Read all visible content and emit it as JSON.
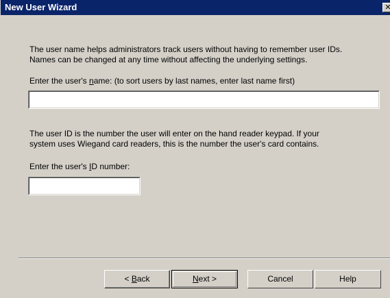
{
  "window": {
    "title": "New User Wizard",
    "close_glyph": "✕"
  },
  "intro": {
    "line1": "The user name helps administrators track users without having to remember user IDs.",
    "line2": "Names can be changed at any time without affecting the underlying settings."
  },
  "name_field": {
    "label_prefix": "Enter the user's ",
    "label_mnemonic": "n",
    "label_rest": "ame: (to sort users by last names, enter last name first)",
    "value": "",
    "placeholder": ""
  },
  "id_info": {
    "line1": "The user ID is the number the user will enter on the hand reader keypad. If your",
    "line2": "system uses Wiegand card readers, this is the number the user's card contains."
  },
  "id_field": {
    "label_prefix": "Enter the user's ",
    "label_mnemonic": "I",
    "label_rest": "D number:",
    "value": "",
    "placeholder": ""
  },
  "buttons": {
    "back_prefix": "< ",
    "back_mnemonic": "B",
    "back_rest": "ack",
    "next_mnemonic": "N",
    "next_rest": "ext >",
    "cancel": "Cancel",
    "help": "Help"
  }
}
